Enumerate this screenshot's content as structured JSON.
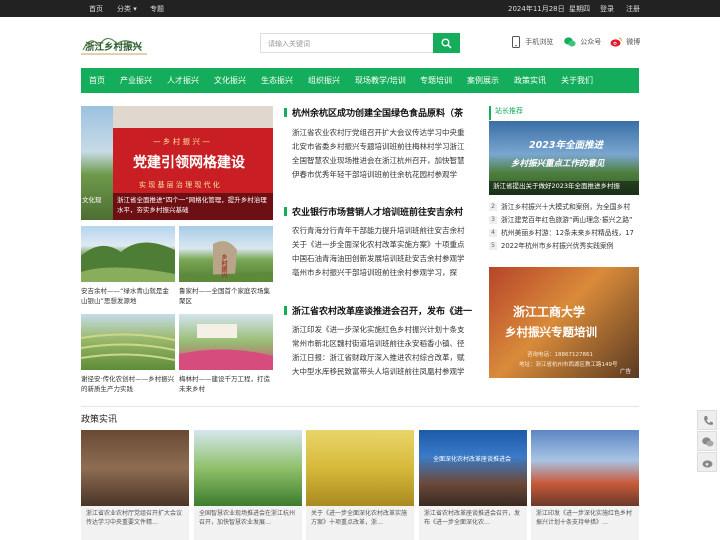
{
  "topbar": {
    "home": "首页",
    "category": "分类",
    "topic": "专题",
    "date": "2024年11月28日",
    "weekday": "星期四",
    "login": "登录",
    "register": "注册"
  },
  "header": {
    "logo_text": "浙江乡村振兴",
    "search_placeholder": "请输入关键词",
    "mobile": "手机浏览",
    "wechat": "公众号",
    "weibo": "微博"
  },
  "nav": [
    "首页",
    "产业振兴",
    "人才振兴",
    "文化振兴",
    "生态振兴",
    "组织振兴",
    "现场教学/培训",
    "专题培训",
    "案例展示",
    "政策实讯",
    "关于我们"
  ],
  "slider": {
    "banner_top": "— 乡 村 振 兴 —",
    "banner_main": "党建引领网格建设",
    "banner_sub": "实 现 基 层 治 理 现 代 化",
    "left_cut": "文化现",
    "caption": "浙江省全面推进“四个一”网格化管理，提升乡村治理水平，夯实乡村振兴基础"
  },
  "thumbs": [
    {
      "caption": "安吉余村——“绿水青山就是金山银山”思想发源地"
    },
    {
      "caption": "鲁家村——全国首个家庭农场集聚区"
    },
    {
      "caption": "谢径安·传化农创村——乡村振兴的新质生产力实践"
    },
    {
      "caption": "梅林村——建设千万工程，打造未来乡村"
    }
  ],
  "thumb_sign": "乡村振兴",
  "news_groups": [
    {
      "title": "杭州余杭区成功创建全国绿色食品原料（茶",
      "items": [
        "浙江省农业农村厅党组召开扩大会议传达学习中央重",
        "北安市省委乡村振兴专题培训班前往梅林村学习浙江",
        "全国智慧农业现场推进会在浙江杭州召开，加快智慧",
        "伊春市优秀年轻干部培训班前往余杭花园村参观学"
      ]
    },
    {
      "title": "农业银行市场营销人才培训班前往安吉余村",
      "items": [
        "农行青海分行青年干部能力提升培训班前往安吉余村",
        "关于《进一步全面深化农村改革实施方案》十项重点",
        "中国石油青海油田创新发展培训班赴安吉余村参观学",
        "亳州市乡村振兴干部培训班前往余村参观学习，探"
      ]
    },
    {
      "title": "浙江省农村改革座谈推进会召开，发布《进一",
      "items": [
        "浙江印发《进一步深化实施红色乡村振兴计划十条支",
        "常州市新北区魏村街道培训班前往永安稻香小镇、径",
        "浙江日报：浙江省财政厅深入推进农村综合改革，赋",
        "大中型水库移民致富带头人培训班前往凤凰村参观学"
      ]
    }
  ],
  "sidebar": {
    "title": "站长推荐",
    "banner_year": "2023年全面推进",
    "banner_sub": "乡村振兴重点工作的意见",
    "banner_caption": "浙江省提出关于做好2023年全面推进乡村振",
    "list": [
      "浙江乡村振兴十大模式和案例，为全国乡村",
      "浙江建党百年红色旅游“两山理念·振兴之路”",
      "杭州美丽乡村游：12条未来乡村精品线，17",
      "2022年杭州市乡村振兴优秀实践案例"
    ],
    "ad_title_1": "浙江工商大学",
    "ad_title_2": "乡村振兴专题培训",
    "ad_phone": "咨询电话：18867127861",
    "ad_address": "地址：浙江省杭州市西湖区教工路149号",
    "ad_tag": "广告"
  },
  "policy": {
    "title": "政策实讯",
    "items": [
      {
        "caption": "浙江省农业农村厅党组召开扩大会议传达学习中央重要文件精…"
      },
      {
        "caption": "全国智慧农业现场推进会在浙江杭州召开，加快智慧农业发展…"
      },
      {
        "caption": "关于《进一步全面深化农村改革实施方案》十项重点改革，浙…"
      },
      {
        "caption": "浙江省农村改革座谈推进会召开，发布《进一步全面深化农…"
      },
      {
        "caption": "浙江印发《进一步深化实施红色乡村振兴计划十条支持举措》…"
      }
    ],
    "card_banner": "全面深化农村改革座谈推进会"
  },
  "float_icons": [
    "phone-icon",
    "wechat-icon",
    "weibo-icon"
  ],
  "colors": {
    "brand": "#14ad5b",
    "top": "#222222",
    "banner_red": "#c81e24"
  }
}
